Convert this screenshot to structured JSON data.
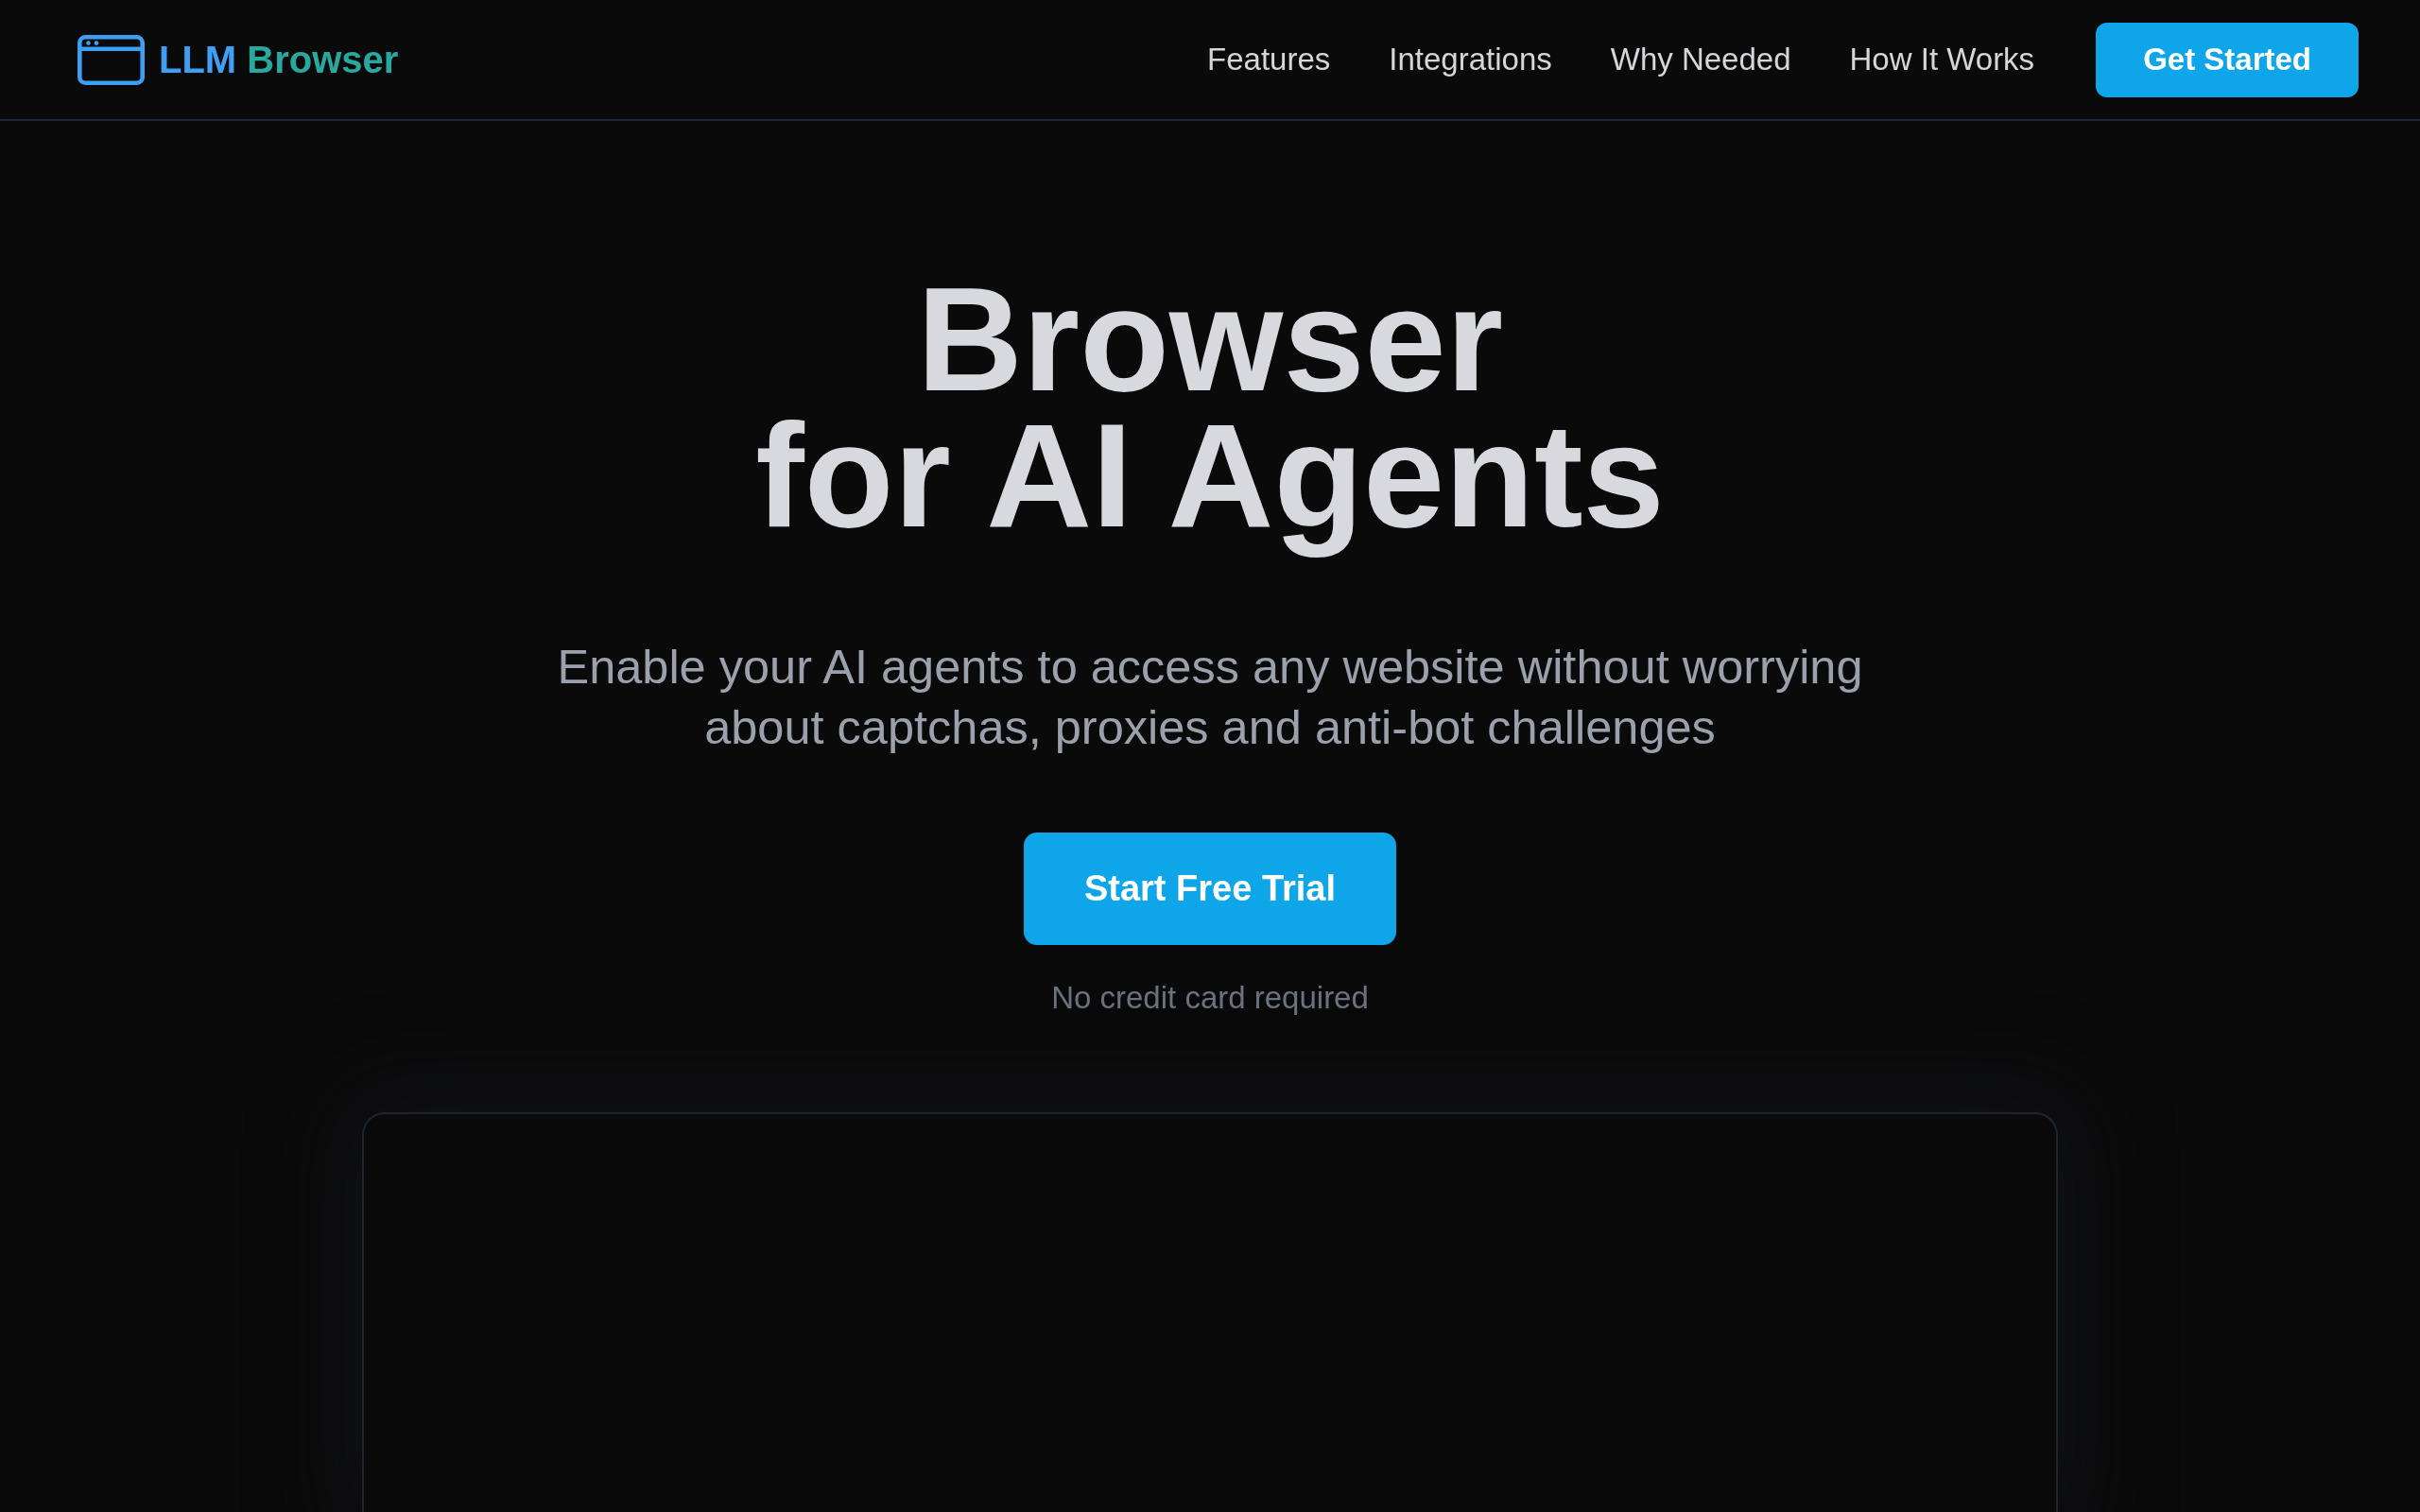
{
  "header": {
    "logo": {
      "parts": [
        "LLM",
        "Browser"
      ]
    },
    "nav": [
      {
        "label": "Features"
      },
      {
        "label": "Integrations"
      },
      {
        "label": "Why Needed"
      },
      {
        "label": "How It Works"
      }
    ],
    "cta_button": "Get Started"
  },
  "hero": {
    "title_lines": [
      "Browser",
      "for AI Agents"
    ],
    "subtitle": "Enable your AI agents to access any website without worrying about captchas, proxies and anti-bot challenges",
    "button": "Start Free Trial",
    "note": "No credit card required"
  }
}
